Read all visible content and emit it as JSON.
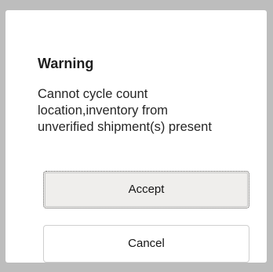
{
  "dialog": {
    "title": "Warning",
    "message": "Cannot cycle count\nlocation,inventory from\nunverified shipment(s) present",
    "accept_label": "Accept",
    "cancel_label": "Cancel"
  }
}
